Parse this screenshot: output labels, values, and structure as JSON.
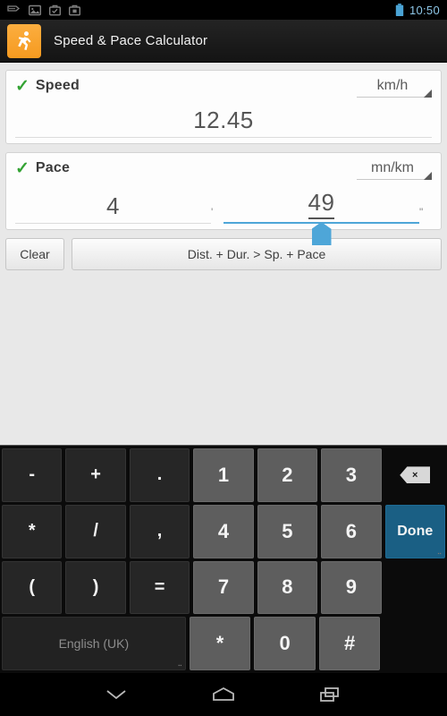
{
  "status_bar": {
    "icons": [
      "usb-icon",
      "screenshot-icon",
      "briefcase-check-icon",
      "briefcase-icon"
    ],
    "battery_icon": "battery-full-icon",
    "time": "10:50",
    "accent_color": "#8ec7e8"
  },
  "action_bar": {
    "app_icon": "running-man-icon",
    "icon_color": "#f59a20",
    "title": "Speed & Pace Calculator"
  },
  "speed_card": {
    "check_icon": "check-icon",
    "check_color": "#34a334",
    "label": "Speed",
    "unit": "km/h",
    "dropdown_icon": "spinner-triangle-icon",
    "value": "12.45"
  },
  "pace_card": {
    "check_icon": "check-icon",
    "check_color": "#34a334",
    "label": "Pace",
    "unit": "mn/km",
    "dropdown_icon": "spinner-triangle-icon",
    "minutes": "4",
    "minutes_mark": "'",
    "seconds": "49",
    "seconds_mark": "\"",
    "focus_color": "#4ea6d8",
    "handle_icon": "text-selection-handle-icon"
  },
  "buttons": {
    "clear": "Clear",
    "convert": "Dist. + Dur. > Sp. + Pace"
  },
  "keyboard": {
    "rows": [
      [
        {
          "label": "-",
          "type": "sym"
        },
        {
          "label": "+",
          "type": "sym"
        },
        {
          "label": ".",
          "type": "sym"
        },
        {
          "label": "1",
          "type": "num"
        },
        {
          "label": "2",
          "type": "num"
        },
        {
          "label": "3",
          "type": "num"
        },
        {
          "label": "",
          "type": "backspace",
          "icon": "backspace-icon"
        }
      ],
      [
        {
          "label": "*",
          "type": "sym"
        },
        {
          "label": "/",
          "type": "sym"
        },
        {
          "label": ",",
          "type": "sym"
        },
        {
          "label": "4",
          "type": "num"
        },
        {
          "label": "5",
          "type": "num"
        },
        {
          "label": "6",
          "type": "num"
        },
        {
          "label": "Done",
          "type": "done"
        }
      ],
      [
        {
          "label": "(",
          "type": "sym"
        },
        {
          "label": ")",
          "type": "sym"
        },
        {
          "label": "=",
          "type": "sym"
        },
        {
          "label": "7",
          "type": "num"
        },
        {
          "label": "8",
          "type": "num"
        },
        {
          "label": "9",
          "type": "num"
        },
        {
          "label": "",
          "type": "blank"
        }
      ],
      [
        {
          "label": "English (UK)",
          "type": "lang"
        },
        {
          "label": "*",
          "type": "num"
        },
        {
          "label": "0",
          "type": "num"
        },
        {
          "label": "#",
          "type": "num"
        },
        {
          "label": "",
          "type": "blank"
        }
      ]
    ],
    "done_color": "#1a5f84",
    "number_key_color": "#5e5e5e",
    "symbol_key_color": "#262626"
  },
  "nav_bar": {
    "back_icon": "chevron-down-icon",
    "home_icon": "home-pentagon-icon",
    "recents_icon": "recents-icon"
  }
}
